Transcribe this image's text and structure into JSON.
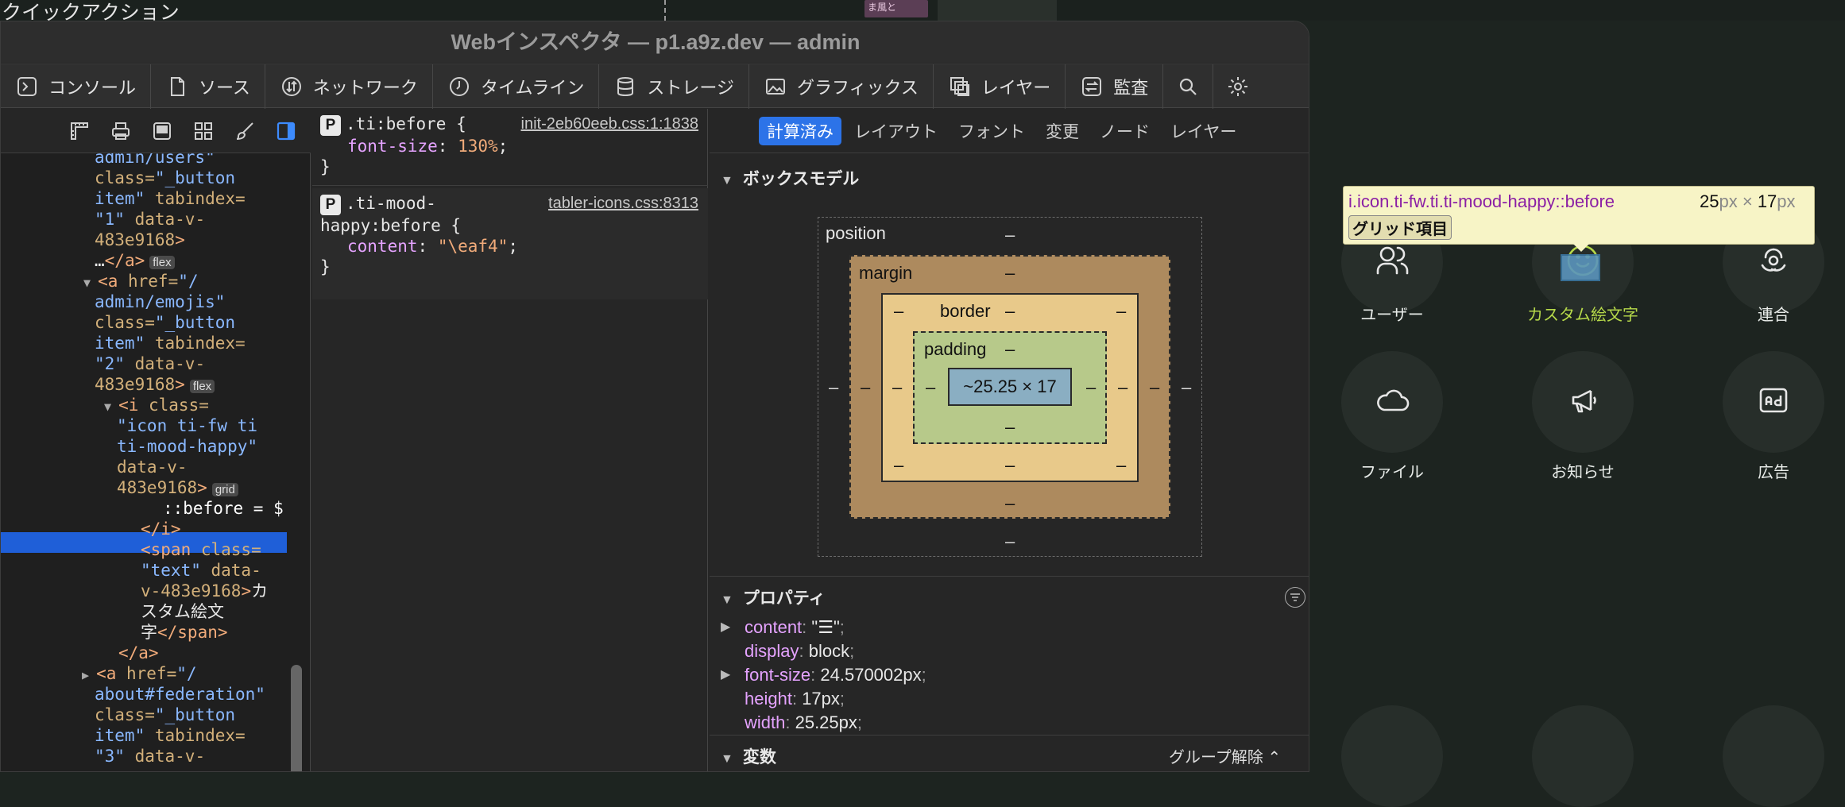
{
  "background": {
    "top_title": "クイックアクション",
    "thumb_text": "ま風と"
  },
  "window": {
    "title": "Webインスペクタ — p1.a9z.dev — admin"
  },
  "tabs": [
    {
      "label": "コンソール",
      "icon": "console-icon"
    },
    {
      "label": "ソース",
      "icon": "document-icon"
    },
    {
      "label": "ネットワーク",
      "icon": "network-icon"
    },
    {
      "label": "タイムライン",
      "icon": "clock-icon"
    },
    {
      "label": "ストレージ",
      "icon": "database-icon"
    },
    {
      "label": "グラフィックス",
      "icon": "image-icon"
    },
    {
      "label": "レイヤー",
      "icon": "layers-icon"
    },
    {
      "label": "監査",
      "icon": "audit-icon"
    }
  ],
  "dom": {
    "lines": [
      {
        "indent": 0,
        "html": "admin/users\""
      },
      {
        "indent": 0,
        "html": "class=\"_button"
      },
      {
        "indent": 0,
        "html": "item\" tabindex="
      },
      {
        "indent": 0,
        "html": "\"1\" data-v-"
      },
      {
        "indent": 0,
        "html": "483e9168\">"
      },
      {
        "indent": 0,
        "html": "…</a>"
      }
    ],
    "chip_flex": "flex",
    "chip_grid": "grid",
    "selected_text": "::before = $"
  },
  "styles": {
    "rule1": {
      "selector": ".ti:before {",
      "source": "init-2eb60eeb.css:1:1838",
      "prop": "font-size",
      "value": "130%",
      "close": "}"
    },
    "rule2": {
      "selector_1": ".ti-mood-",
      "selector_2": "happy:before {",
      "source": "tabler-icons.css:8313",
      "prop": "content",
      "value": "\"\\eaf4\"",
      "close": "}"
    }
  },
  "computed": {
    "tabs": [
      "計算済み",
      "レイアウト",
      "フォント",
      "変更",
      "ノード",
      "レイヤー"
    ],
    "active_tab": 0,
    "box_model_title": "ボックスモデル",
    "box": {
      "position": "position",
      "margin": "margin",
      "border": "border",
      "padding": "padding",
      "content": "~25.25 × 17",
      "dash": "–"
    },
    "properties_title": "プロパティ",
    "properties": [
      {
        "name": "content",
        "value": "\"☰\"",
        "expandable": true
      },
      {
        "name": "display",
        "value": "block",
        "expandable": false
      },
      {
        "name": "font-size",
        "value": "24.570002px",
        "expandable": true
      },
      {
        "name": "height",
        "value": "17px",
        "expandable": false
      },
      {
        "name": "width",
        "value": "25.25px",
        "expandable": false
      }
    ],
    "variables_title": "変数",
    "ungroup_label": "グループ解除 ⌃"
  },
  "tooltip": {
    "selector": "i.icon.ti-fw.ti.ti-mood-happy::before",
    "w": "25",
    "h": "17",
    "unit": "px",
    "x": " × ",
    "badge": "グリッド項目"
  },
  "apps": [
    {
      "label": "ユーザー",
      "icon": "users-icon",
      "active": false
    },
    {
      "label": "カスタム絵文字",
      "icon": "mood-happy-icon",
      "active": true
    },
    {
      "label": "連合",
      "icon": "federation-icon",
      "active": false
    },
    {
      "label": "ファイル",
      "icon": "cloud-icon",
      "active": false
    },
    {
      "label": "お知らせ",
      "icon": "speakerphone-icon",
      "active": false
    },
    {
      "label": "広告",
      "icon": "ad-icon",
      "active": false
    }
  ]
}
